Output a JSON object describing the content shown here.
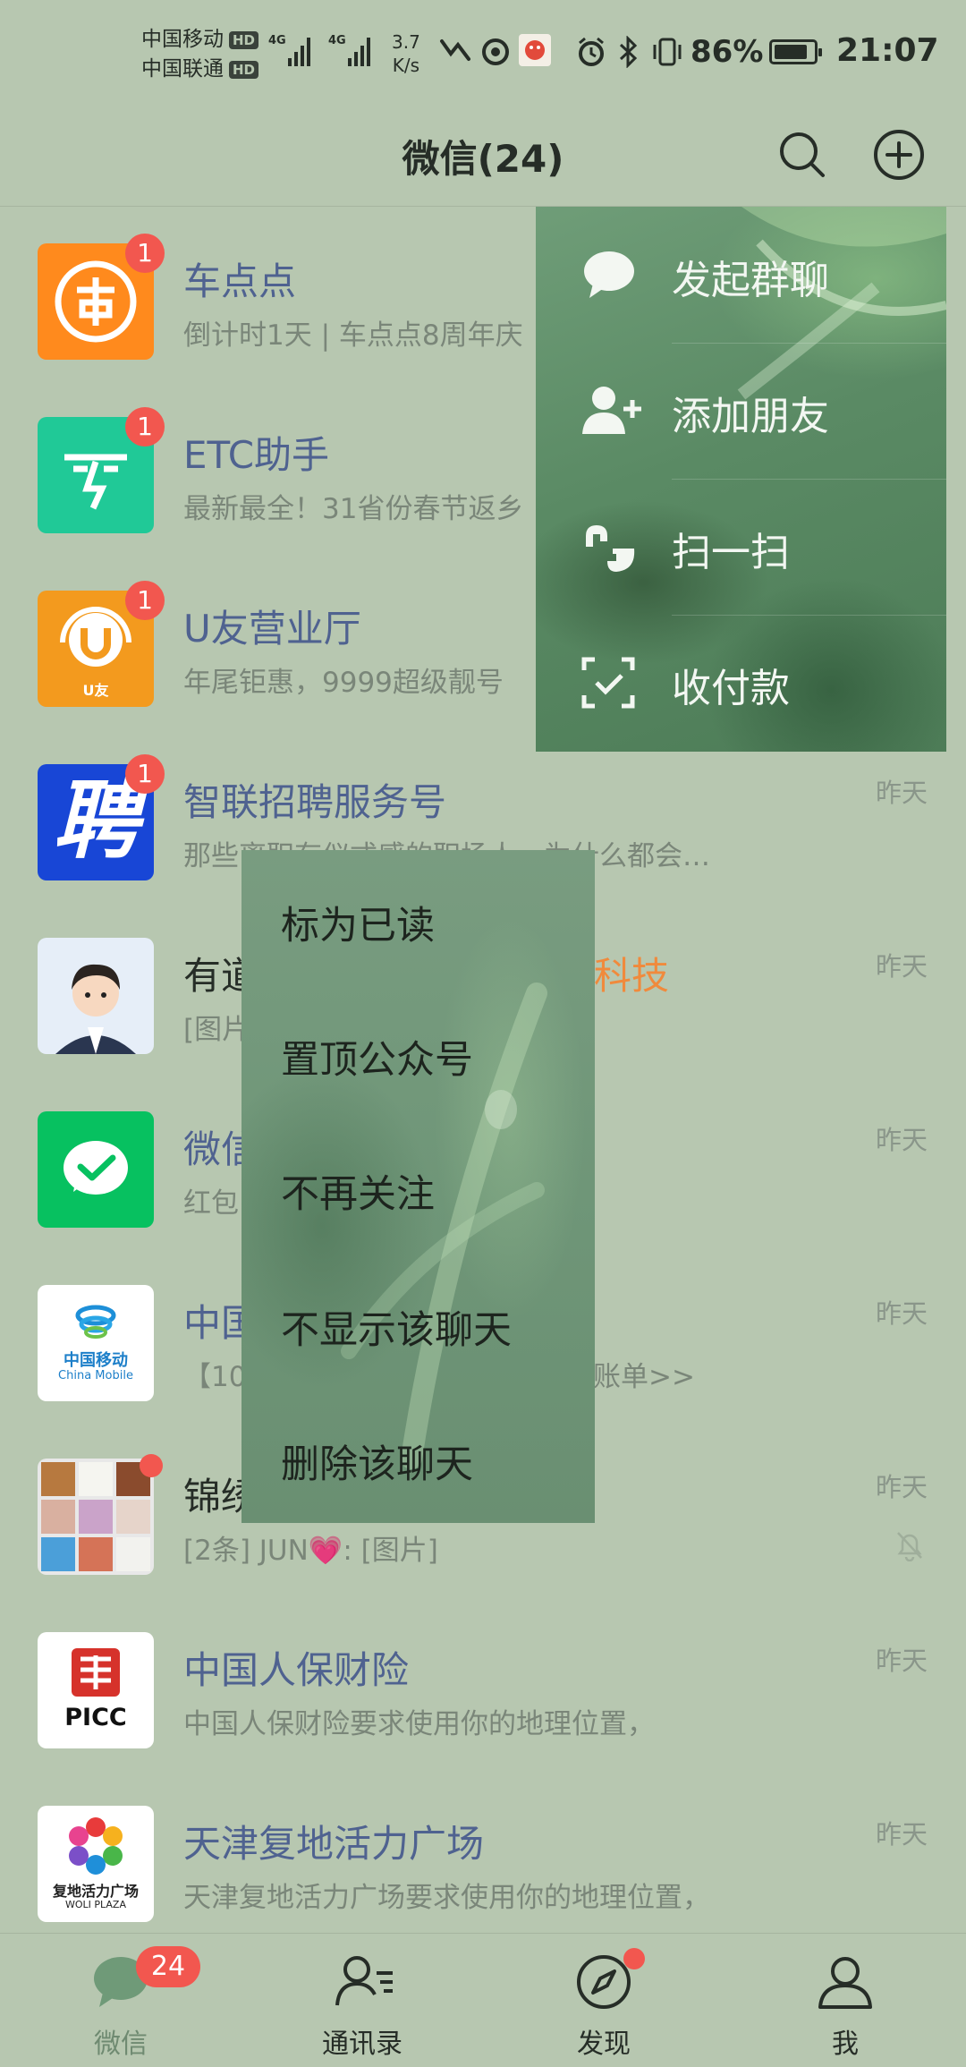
{
  "status_bar": {
    "carrier_1": "中国移动",
    "carrier_2": "中国联通",
    "hd": "HD",
    "signal_1": "4G",
    "signal_2": "4G",
    "speed_value": "3.7",
    "speed_unit": "K/s",
    "battery": "86%",
    "battery_level": 0.86,
    "time": "21:07"
  },
  "header": {
    "title": "微信(24)",
    "icons": [
      "search-icon",
      "plus-circle-icon"
    ]
  },
  "chats": [
    {
      "name": "车点点",
      "message": "倒计时1天 | 车点点8周年庆",
      "time": "",
      "badge": "1"
    },
    {
      "name": "ETC助手",
      "message": "最新最全！31省份春节返乡",
      "time": "",
      "badge": "1"
    },
    {
      "name": "U友营业厅",
      "message": "年尾钜惠，9999超级靓号",
      "time": "",
      "badge": "1"
    },
    {
      "name": "智联招聘服务号",
      "message": "那些离职有仪式感的职场人，为什么都会…",
      "time": "昨天",
      "badge": "1"
    },
    {
      "name": "有道",
      "name_suffix": "科技",
      "message": "[图片]",
      "time": "昨天"
    },
    {
      "name": "微信",
      "message": "红包",
      "time": "昨天"
    },
    {
      "name": "中国",
      "message": "【10",
      "message_suffix": "账单>>",
      "time": "昨天"
    },
    {
      "name": "锦绣",
      "message": "[2条] JUN💗: [图片]",
      "time": "昨天",
      "dot": true,
      "muted": true
    },
    {
      "name": "中国人保财险",
      "message": "中国人保财险要求使用你的地理位置，",
      "time": "昨天"
    },
    {
      "name": "天津复地活力广场",
      "message": "天津复地活力广场要求使用你的地理位置，",
      "time": "昨天"
    }
  ],
  "avatars": {
    "chinamobile_cn": "中国移动",
    "chinamobile_en": "China Mobile",
    "picc": "PICC",
    "uyou": "U友",
    "zhaopin": "聘",
    "woli": "复地活力广场",
    "woli_en": "WOLI PLAZA"
  },
  "plus_menu": [
    {
      "label": "发起群聊",
      "icon": "chat-bubble-icon"
    },
    {
      "label": "添加朋友",
      "icon": "add-friend-icon"
    },
    {
      "label": "扫一扫",
      "icon": "scan-icon"
    },
    {
      "label": "收付款",
      "icon": "payment-icon"
    }
  ],
  "context_menu": [
    "标为已读",
    "置顶公众号",
    "不再关注",
    "不显示该聊天",
    "删除该聊天"
  ],
  "tabs": [
    {
      "label": "微信",
      "badge": "24",
      "icon": "chat-tab-icon",
      "active": true
    },
    {
      "label": "通讯录",
      "icon": "contacts-icon"
    },
    {
      "label": "发现",
      "icon": "compass-icon",
      "dot": true
    },
    {
      "label": "我",
      "icon": "person-icon"
    }
  ],
  "colors": {
    "overlay_bg": "#b7c7b0",
    "badge_red": "#f2574f",
    "name_blue": "#4f6290",
    "highlight_orange": "#f08a3c",
    "wechat_green": "#07c160"
  }
}
